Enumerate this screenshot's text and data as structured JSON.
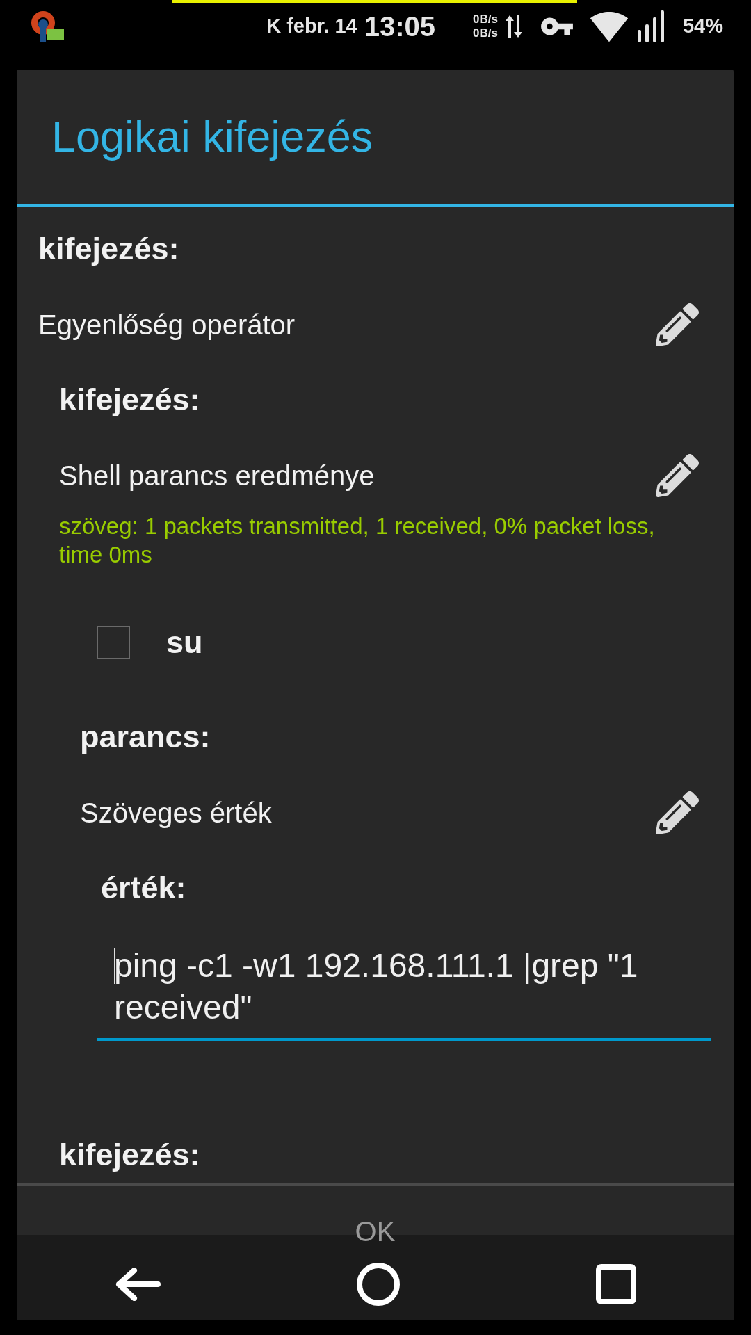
{
  "status_bar": {
    "date": "K febr. 14",
    "time": "13:05",
    "upload": "0B/s",
    "download": "0B/s",
    "battery": "54%"
  },
  "dialog": {
    "title": "Logikai kifejezés",
    "items": [
      {
        "kind": "label",
        "text": "kifejezés:"
      },
      {
        "kind": "editable",
        "text": "Egyenlőség operátor",
        "children": [
          {
            "kind": "label",
            "text": "kifejezés:"
          },
          {
            "kind": "editable",
            "text": "Shell parancs eredménye",
            "detail": "szöveg: 1 packets transmitted, 1 received, 0% packet loss, time 0ms",
            "children": [
              {
                "kind": "checkbox",
                "text": "su",
                "checked": false
              },
              {
                "kind": "label",
                "text": "parancs:"
              },
              {
                "kind": "editable",
                "text": "Szöveges érték",
                "children": [
                  {
                    "kind": "label",
                    "text": "érték:"
                  },
                  {
                    "kind": "input",
                    "value": "ping -c1 -w1 192.168.111.1 |grep \"1 received\""
                  }
                ]
              }
            ]
          },
          {
            "kind": "label",
            "text": "kifejezés:"
          }
        ]
      }
    ],
    "button": "OK"
  }
}
